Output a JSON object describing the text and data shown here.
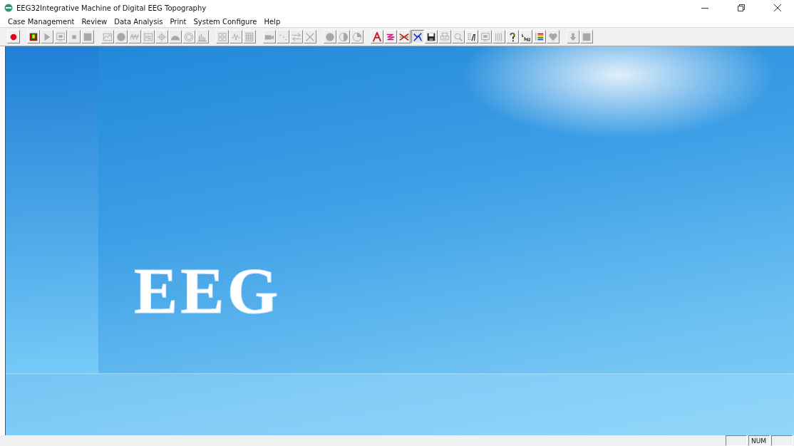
{
  "window": {
    "title": "EEG32Integrative Machine of Digital EEG Topography"
  },
  "menu": [
    "Case Management",
    "Review",
    "Data Analysis",
    "Print",
    "System Configure",
    "Help"
  ],
  "toolbar": [
    [
      {
        "kind": "record",
        "disabled": false,
        "pressed": false
      }
    ],
    [
      {
        "kind": "blocks",
        "disabled": false,
        "pressed": false
      },
      {
        "kind": "play",
        "disabled": true,
        "pressed": false
      },
      {
        "kind": "monitor",
        "disabled": true,
        "pressed": false
      },
      {
        "kind": "stop",
        "disabled": true,
        "pressed": false
      },
      {
        "kind": "square",
        "disabled": true,
        "pressed": false
      }
    ],
    [
      {
        "kind": "wave",
        "disabled": true,
        "pressed": false
      },
      {
        "kind": "disc",
        "disabled": true,
        "pressed": false
      },
      {
        "kind": "spikes",
        "disabled": true,
        "pressed": false
      },
      {
        "kind": "hz",
        "disabled": true,
        "pressed": false
      },
      {
        "kind": "crosshair",
        "disabled": true,
        "pressed": false
      },
      {
        "kind": "dome",
        "disabled": true,
        "pressed": false
      },
      {
        "kind": "rings",
        "disabled": true,
        "pressed": false
      },
      {
        "kind": "bars",
        "disabled": true,
        "pressed": false
      }
    ],
    [
      {
        "kind": "grid",
        "disabled": true,
        "pressed": false
      },
      {
        "kind": "pulse",
        "disabled": true,
        "pressed": false
      },
      {
        "kind": "table",
        "disabled": true,
        "pressed": false
      }
    ],
    [
      {
        "kind": "camera",
        "disabled": true,
        "pressed": false
      },
      {
        "kind": "dots",
        "disabled": true,
        "pressed": false
      },
      {
        "kind": "swap",
        "disabled": true,
        "pressed": false
      },
      {
        "kind": "cross",
        "disabled": true,
        "pressed": false
      }
    ],
    [
      {
        "kind": "disc",
        "disabled": true,
        "pressed": false
      },
      {
        "kind": "half",
        "disabled": true,
        "pressed": false
      },
      {
        "kind": "pie",
        "disabled": true,
        "pressed": false
      }
    ],
    [
      {
        "kind": "letter",
        "disabled": false,
        "pressed": false
      },
      {
        "kind": "zigzag",
        "disabled": false,
        "pressed": false
      },
      {
        "kind": "crosslines",
        "disabled": false,
        "pressed": false
      },
      {
        "kind": "crossblue",
        "disabled": false,
        "pressed": true
      },
      {
        "kind": "floppy",
        "disabled": false,
        "pressed": false
      },
      {
        "kind": "printer",
        "disabled": true,
        "pressed": false
      },
      {
        "kind": "preview",
        "disabled": true,
        "pressed": false
      },
      {
        "kind": "text",
        "disabled": false,
        "pressed": false
      },
      {
        "kind": "monitor",
        "disabled": true,
        "pressed": false
      },
      {
        "kind": "lines",
        "disabled": true,
        "pressed": false
      },
      {
        "kind": "help",
        "disabled": false,
        "pressed": false
      },
      {
        "kind": "trace",
        "disabled": false,
        "pressed": false
      },
      {
        "kind": "colorbars",
        "disabled": false,
        "pressed": false
      },
      {
        "kind": "heart",
        "disabled": true,
        "pressed": false
      }
    ],
    [
      {
        "kind": "down",
        "disabled": true,
        "pressed": false
      },
      {
        "kind": "square",
        "disabled": true,
        "pressed": false
      }
    ]
  ],
  "splash": {
    "logo": "EEG"
  },
  "status_bar": {
    "indicator": "NUM"
  }
}
